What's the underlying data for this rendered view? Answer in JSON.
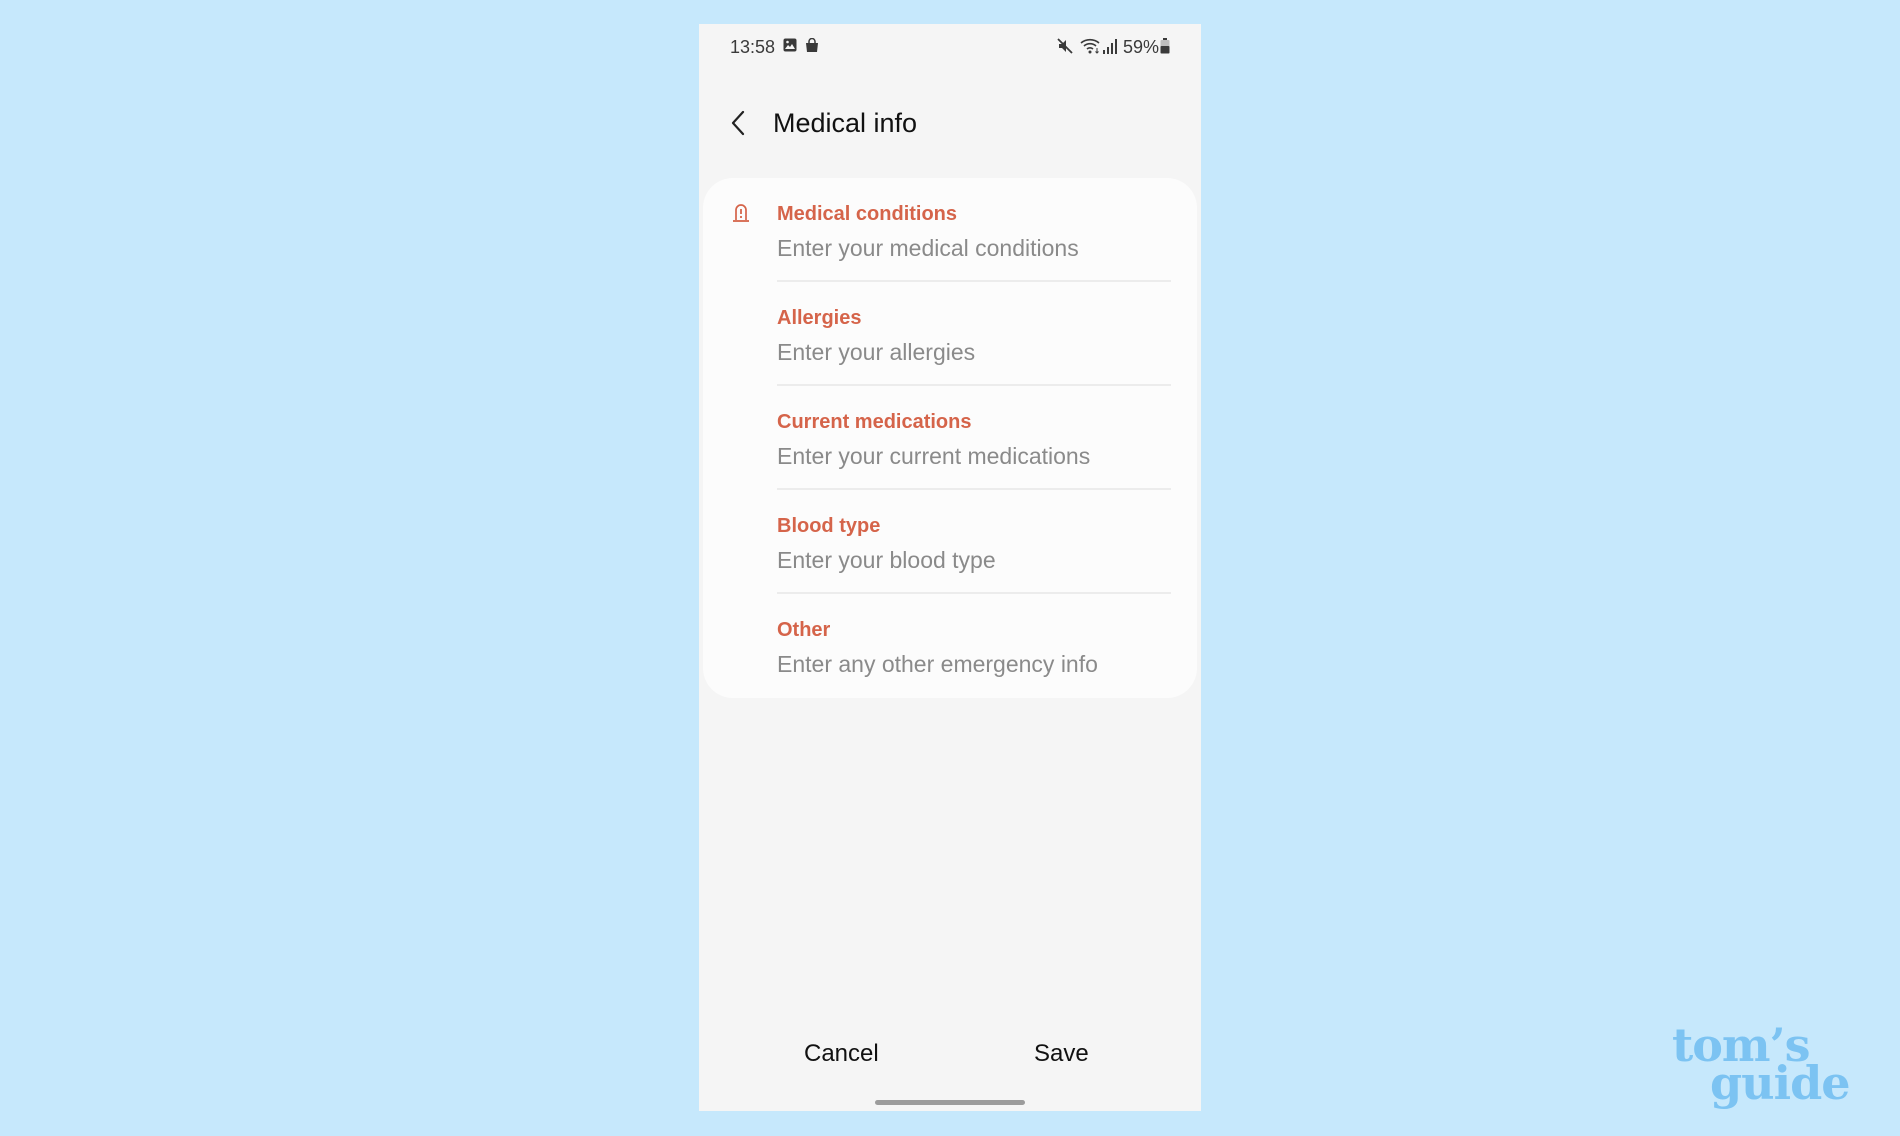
{
  "status_bar": {
    "time": "13:58",
    "left_icons": [
      "gallery-icon",
      "shopping-bag-icon"
    ],
    "right_icons": [
      "mute-icon",
      "wifi-icon",
      "signal-icon"
    ],
    "battery": "59%"
  },
  "header": {
    "back_icon": "chevron-left-icon",
    "title": "Medical info"
  },
  "fields": [
    {
      "label": "Medical conditions",
      "placeholder": "Enter your medical conditions",
      "icon": "medical-alert-icon"
    },
    {
      "label": "Allergies",
      "placeholder": "Enter your allergies"
    },
    {
      "label": "Current medications",
      "placeholder": "Enter your current medications"
    },
    {
      "label": "Blood type",
      "placeholder": "Enter your blood type"
    },
    {
      "label": "Other",
      "placeholder": "Enter any other emergency info"
    }
  ],
  "footer": {
    "cancel_label": "Cancel",
    "save_label": "Save"
  },
  "watermark": {
    "line1": "tom’s",
    "line2": "guide"
  },
  "colors": {
    "accent": "#d5644a",
    "background": "#c6e8fc",
    "logo": "#7cc3f2"
  }
}
